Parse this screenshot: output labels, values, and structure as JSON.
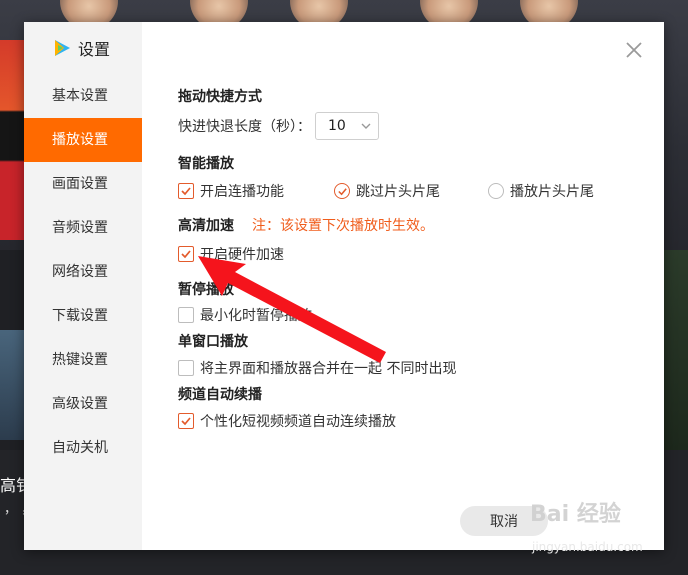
{
  "sidebar": {
    "title": "设置",
    "items": [
      {
        "label": "基本设置",
        "active": false
      },
      {
        "label": "播放设置",
        "active": true
      },
      {
        "label": "画面设置",
        "active": false
      },
      {
        "label": "音频设置",
        "active": false
      },
      {
        "label": "网络设置",
        "active": false
      },
      {
        "label": "下载设置",
        "active": false
      },
      {
        "label": "热键设置",
        "active": false
      },
      {
        "label": "高级设置",
        "active": false
      },
      {
        "label": "自动关机",
        "active": false
      }
    ]
  },
  "drag_shortcut": {
    "title": "拖动快捷方式",
    "label": "快进快退长度（秒）：",
    "value": "10"
  },
  "smart_play": {
    "title": "智能播放",
    "options": [
      {
        "label": "开启连播功能",
        "checked": true
      },
      {
        "label": "跳过片头片尾",
        "checked": true
      },
      {
        "label": "播放片头片尾",
        "checked": false
      }
    ]
  },
  "hd_accel": {
    "title": "高清加速",
    "note": "注：该设置下次播放时生效。",
    "option": {
      "label": "开启硬件加速",
      "checked": true
    }
  },
  "pause_play": {
    "title": "暂停播放",
    "option": {
      "label": "最小化时暂停播放",
      "checked": false
    }
  },
  "single_window": {
    "title": "单窗口播放",
    "option": {
      "label": "将主界面和播放器合并在一起 不同时出现",
      "checked": false
    }
  },
  "channel_auto": {
    "title": "频道自动续播",
    "option": {
      "label": "个性化短视频频道自动连续播放",
      "checked": true
    }
  },
  "footer": {
    "cancel_label": "取消"
  },
  "watermark": {
    "main": "Bai 经验",
    "sub": "jingyan.baidu.com"
  },
  "background": {
    "text": "高钅",
    "comma": "，  ，"
  },
  "colors": {
    "accent": "#ff6a00",
    "check": "#e35b2c",
    "note": "#f05d1c",
    "annotation": "#f5141c"
  }
}
